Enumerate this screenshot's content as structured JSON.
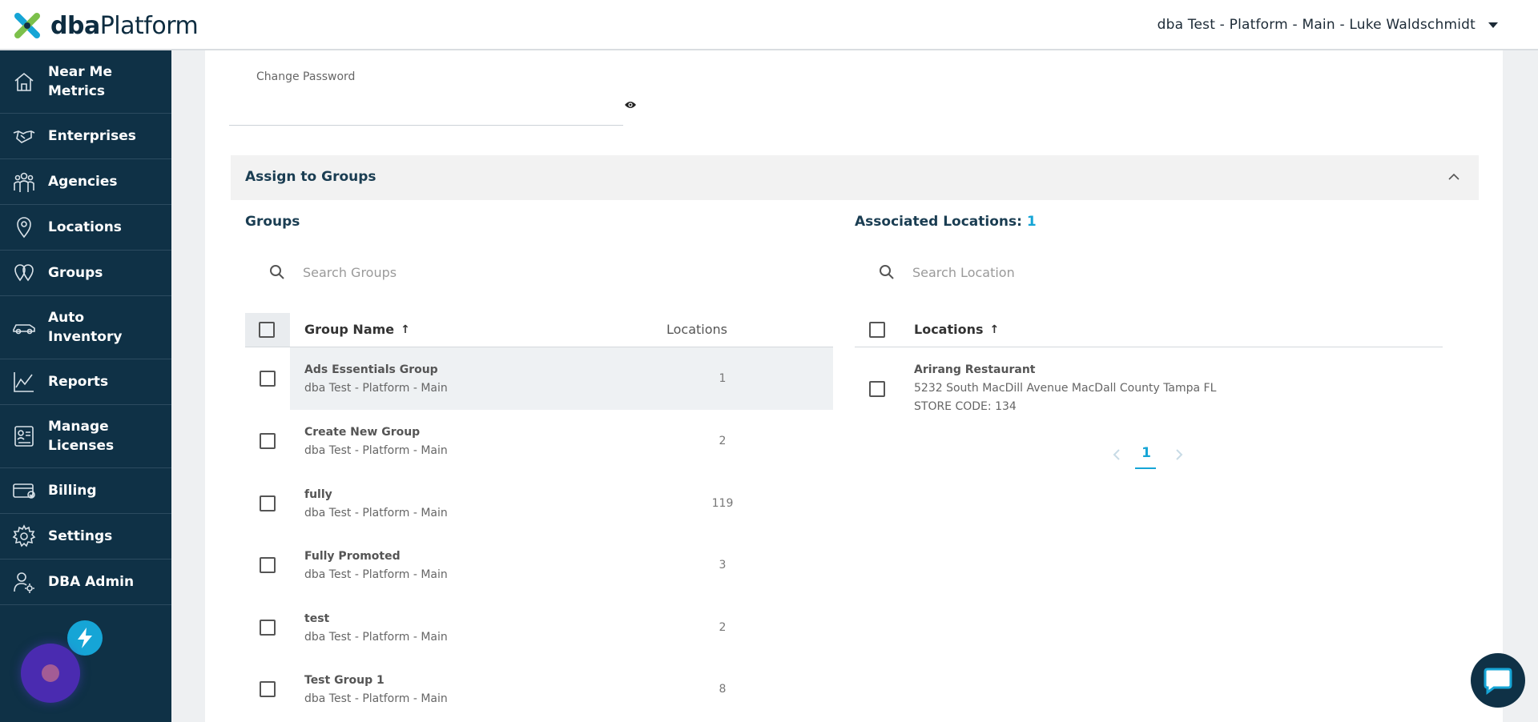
{
  "header": {
    "brand_bold": "dba",
    "brand_rest": "Platform",
    "account": "dba Test - Platform - Main - Luke Waldschmidt"
  },
  "sidebar": {
    "items": [
      {
        "label": "Near Me Metrics",
        "icon": "home-icon"
      },
      {
        "label": "Enterprises",
        "icon": "handshake-icon"
      },
      {
        "label": "Agencies",
        "icon": "people-icon"
      },
      {
        "label": "Locations",
        "icon": "map-pin-icon"
      },
      {
        "label": "Groups",
        "icon": "group-pins-icon"
      },
      {
        "label": "Auto Inventory",
        "icon": "car-icon"
      },
      {
        "label": "Reports",
        "icon": "chart-icon"
      },
      {
        "label": "Manage Licenses",
        "icon": "license-icon"
      },
      {
        "label": "Billing",
        "icon": "billing-icon"
      },
      {
        "label": "Settings",
        "icon": "gear-icon"
      },
      {
        "label": "DBA Admin",
        "icon": "admin-user-icon"
      }
    ]
  },
  "password": {
    "label": "Change Password"
  },
  "assign": {
    "title": "Assign to Groups",
    "groups_title": "Groups",
    "assoc_title": "Associated Locations:",
    "assoc_count": "1",
    "search_groups_placeholder": "Search Groups",
    "search_location_placeholder": "Search Location",
    "col_group_name": "Group Name",
    "col_locations": "Locations",
    "col_locations_right": "Locations",
    "groups": [
      {
        "name": "Ads Essentials Group",
        "account": "dba Test - Platform - Main",
        "count": "1"
      },
      {
        "name": "Create New Group",
        "account": "dba Test - Platform - Main",
        "count": "2"
      },
      {
        "name": "fully",
        "account": "dba Test - Platform - Main",
        "count": "119"
      },
      {
        "name": "Fully Promoted",
        "account": "dba Test - Platform - Main",
        "count": "3"
      },
      {
        "name": "test",
        "account": "dba Test - Platform - Main",
        "count": "2"
      },
      {
        "name": "Test Group 1",
        "account": "dba Test - Platform - Main",
        "count": "8"
      }
    ],
    "locations": [
      {
        "name": "Arirang Restaurant",
        "address": "5232 South MacDill Avenue MacDall County Tampa FL",
        "store_code": "STORE CODE: 134"
      }
    ],
    "page": "1"
  },
  "colors": {
    "sidebar": "#0f3146",
    "accent": "#16a5d6",
    "heading": "#1a3d52"
  }
}
